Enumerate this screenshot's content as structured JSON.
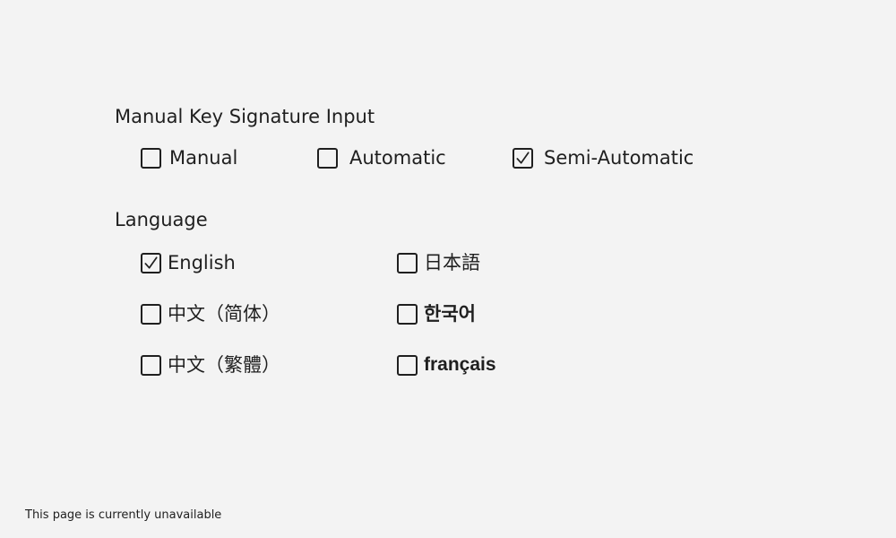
{
  "key_signature": {
    "title": "Manual Key Signature Input",
    "options": [
      {
        "label": "Manual",
        "checked": false
      },
      {
        "label": "Automatic",
        "checked": false
      },
      {
        "label": "Semi-Automatic",
        "checked": true
      }
    ]
  },
  "language": {
    "title": "Language",
    "options": [
      {
        "label": "English",
        "checked": true
      },
      {
        "label": "日本語",
        "checked": false
      },
      {
        "label": "中文（简体）",
        "checked": false
      },
      {
        "label": "한국어",
        "checked": false
      },
      {
        "label": "中文（繁體）",
        "checked": false
      },
      {
        "label": "français",
        "checked": false
      }
    ]
  },
  "footer": {
    "text": "This page is currently unavailable"
  }
}
